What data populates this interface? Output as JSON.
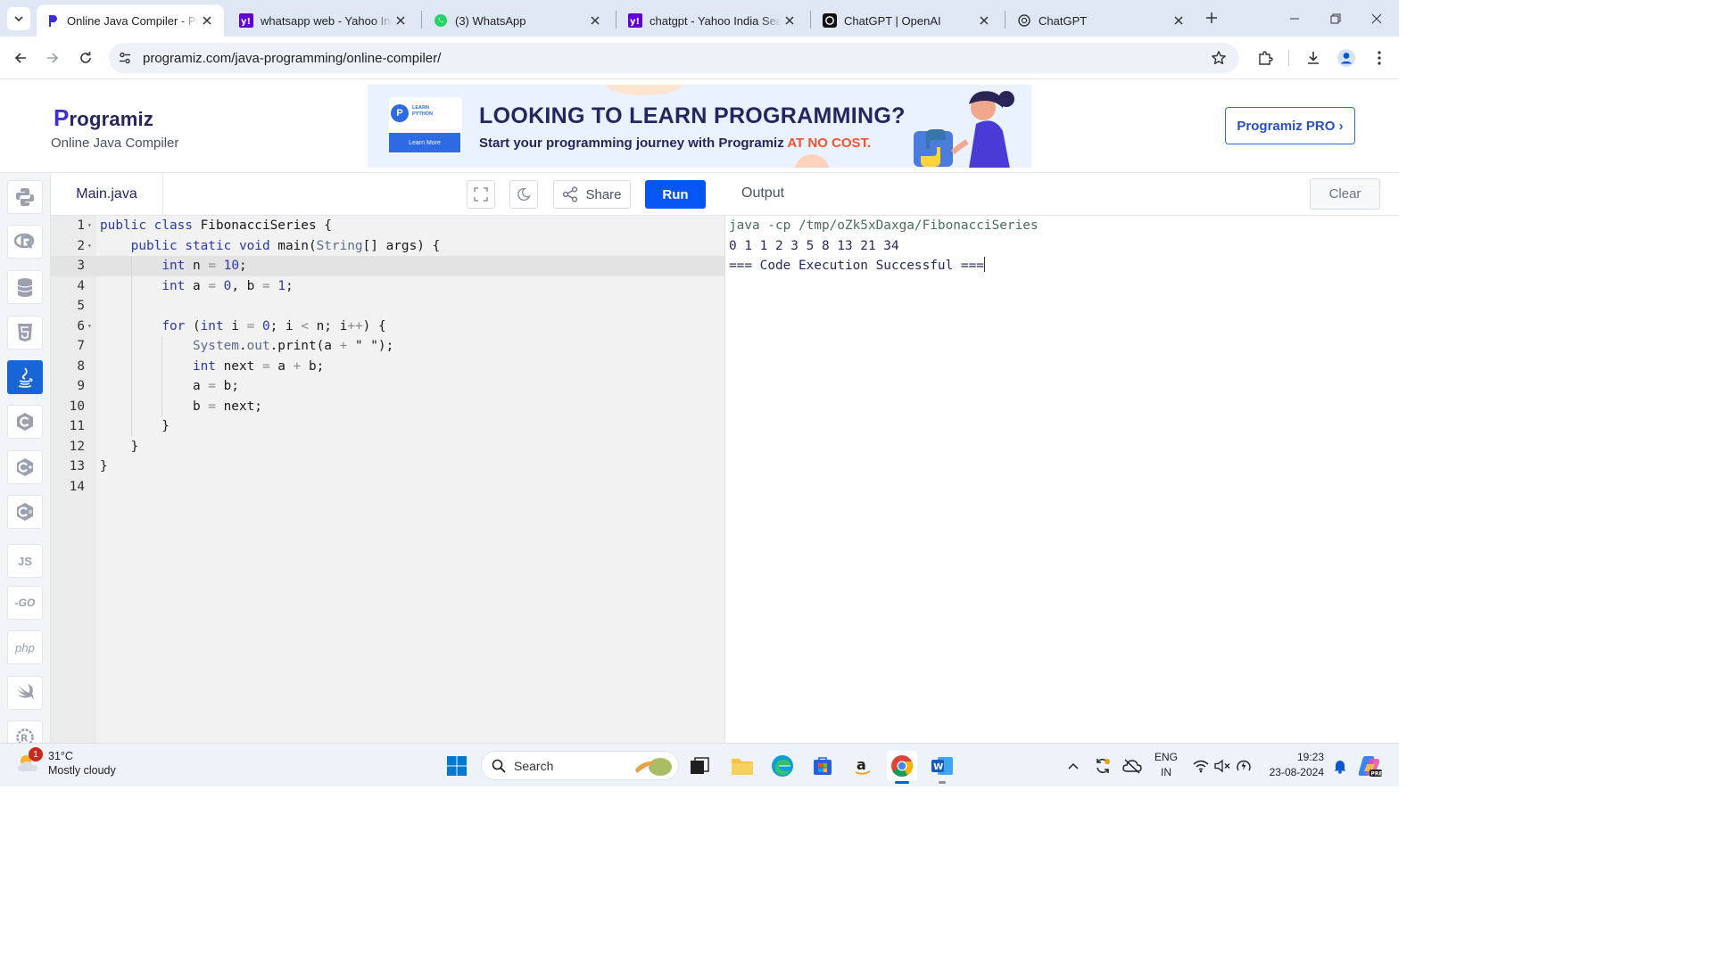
{
  "browser": {
    "tabs": [
      {
        "title": "Online Java Compiler - Programiz",
        "favicon": "programiz-icon"
      },
      {
        "title": "whatsapp web - Yahoo India Search",
        "favicon": "yahoo-icon"
      },
      {
        "title": "(3) WhatsApp",
        "favicon": "whatsapp-icon"
      },
      {
        "title": "chatgpt - Yahoo India Search",
        "favicon": "yahoo-icon"
      },
      {
        "title": "ChatGPT | OpenAI",
        "favicon": "openai-icon"
      },
      {
        "title": "ChatGPT",
        "favicon": "openai-icon"
      }
    ],
    "url": "programiz.com/java-programming/online-compiler/"
  },
  "header": {
    "logo_text": "rogramiz",
    "logo_initial": "P",
    "subtitle": "Online Java Compiler",
    "banner": {
      "card_label_1": "LEARN",
      "card_label_2": "PYTHON",
      "card_button": "Learn More",
      "headline": "LOOKING TO LEARN PROGRAMMING?",
      "tagline": "Start your programming journey with Programiz ",
      "tagline_highlight": "AT NO COST."
    },
    "pro_button": "Programiz PRO ›"
  },
  "languages": [
    {
      "name": "python-icon"
    },
    {
      "name": "r-icon"
    },
    {
      "name": "sql-icon"
    },
    {
      "name": "html-icon"
    },
    {
      "name": "java-icon",
      "active": true
    },
    {
      "name": "c-icon"
    },
    {
      "name": "cpp-icon"
    },
    {
      "name": "csharp-icon"
    },
    {
      "name": "js-icon",
      "label": "JS"
    },
    {
      "name": "go-icon",
      "label": "-GO"
    },
    {
      "name": "php-icon",
      "label": "php"
    },
    {
      "name": "swift-icon"
    },
    {
      "name": "rust-icon"
    }
  ],
  "editor": {
    "filename": "Main.java",
    "share_label": "Share",
    "run_label": "Run",
    "active_line": 3,
    "lines": [
      "public class FibonacciSeries {",
      "    public static void main(String[] args) {",
      "        int n = 10;",
      "        int a = 0, b = 1;",
      "",
      "        for (int i = 0; i < n; i++) {",
      "            System.out.print(a + \" \");",
      "            int next = a + b;",
      "            a = b;",
      "            b = next;",
      "        }",
      "    }",
      "}",
      ""
    ]
  },
  "output": {
    "title": "Output",
    "clear_label": "Clear",
    "command": "java -cp /tmp/oZk5xDaxga/FibonacciSeries",
    "result": "0 1 1 2 3 5 8 13 21 34",
    "status": "=== Code Execution Successful ==="
  },
  "taskbar": {
    "weather_temp": "31°C",
    "weather_desc": "Mostly cloudy",
    "weather_badge": "1",
    "search_placeholder": "Search",
    "lang_line1": "ENG",
    "lang_line2": "IN",
    "time": "19:23",
    "date": "23-08-2024"
  }
}
